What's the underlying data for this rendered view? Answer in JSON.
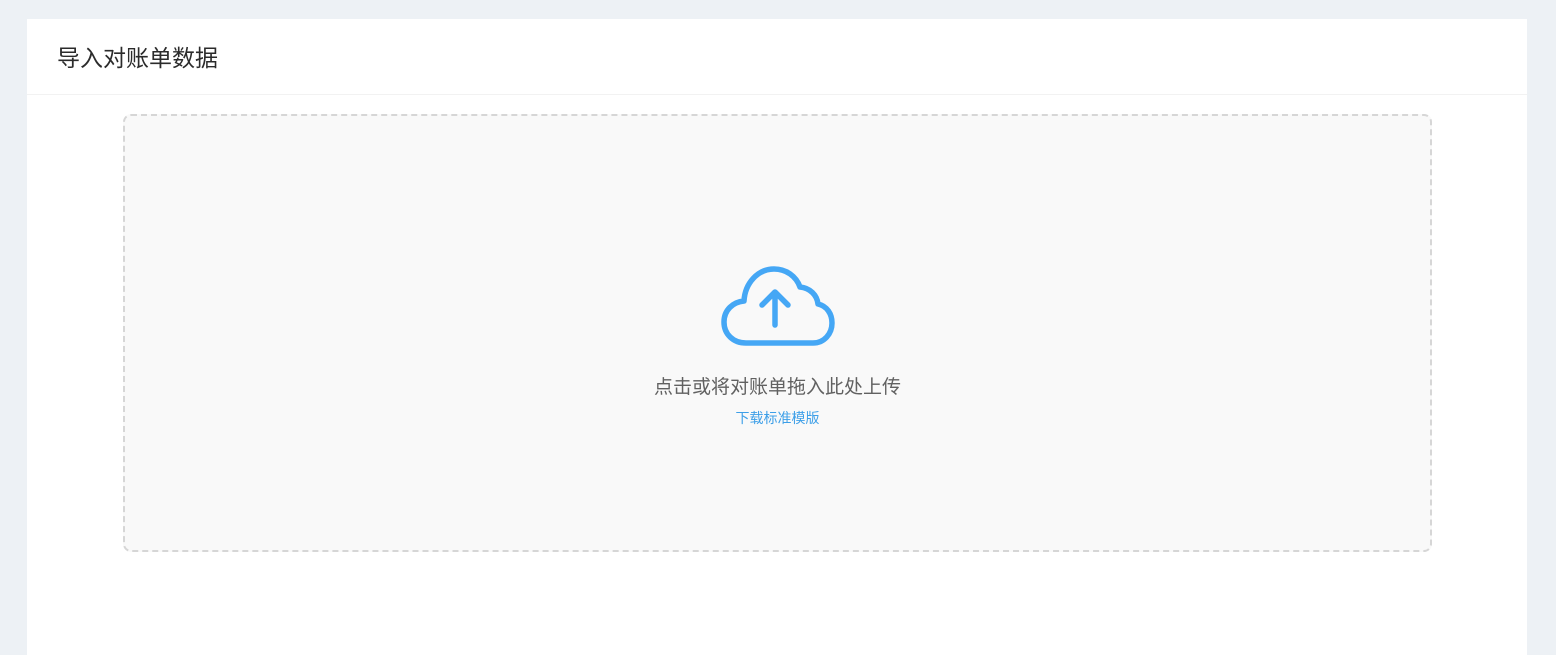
{
  "page": {
    "title": "导入对账单数据"
  },
  "upload": {
    "icon": "cloud-upload-icon",
    "prompt": "点击或将对账单拖入此处上传",
    "template_link": "下载标准模版"
  },
  "colors": {
    "accent": "#3d9fe8",
    "icon": "#45a7f5",
    "background": "#edf1f5",
    "dropzone_bg": "#f9f9f9",
    "dropzone_border": "#d6d6d6"
  }
}
